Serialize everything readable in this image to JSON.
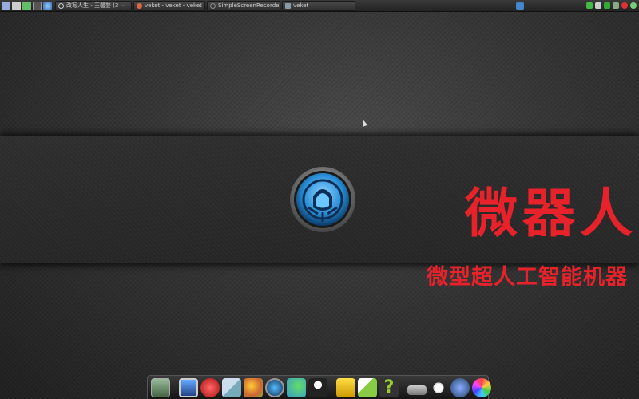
{
  "taskbar": {
    "launcher_icons": [
      "system-icon",
      "user-icon",
      "refresh-icon",
      "terminal-icon",
      "browser-icon"
    ],
    "tasks": [
      {
        "label": "改写人生 - 王馨婺 (3 ⋯",
        "icon": "clock-icon"
      },
      {
        "label": "veket - veket - veket",
        "icon": "browser-icon"
      },
      {
        "label": "SimpleScreenRecorder",
        "icon": "record-icon"
      },
      {
        "label": "veket",
        "icon": "folder-icon"
      }
    ],
    "tray_icons": [
      "network-icon",
      "shield-icon",
      "volume-icon",
      "display-icon",
      "clipboard-icon",
      "power-icon",
      "globe-icon"
    ]
  },
  "desktop": {
    "brand_title": "微器人",
    "brand_subtitle": "微型超人工智能机器"
  },
  "dock": {
    "icons": [
      "terminal-icon",
      "monitor-icon",
      "red-app-icon",
      "text-editor-icon",
      "paint-icon",
      "media-player-icon",
      "network-users-icon",
      "penguin-icon",
      "folder-icon",
      "image-viewer-icon",
      "help-icon",
      "drive-icon",
      "brightness-icon",
      "globe-icon",
      "color-orb-icon"
    ]
  },
  "colors": {
    "brand_red": "#e8222a",
    "logo_blue": "#3aa4e8"
  }
}
